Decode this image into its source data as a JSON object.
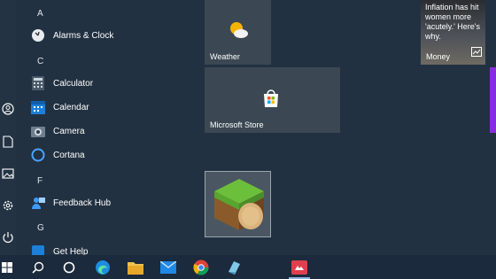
{
  "applist": {
    "sections": [
      {
        "letter": "A"
      },
      {
        "letter": "C"
      },
      {
        "letter": "F"
      },
      {
        "letter": "G"
      }
    ],
    "apps": [
      {
        "label": "Alarms & Clock",
        "icon": "alarm-clock-icon"
      },
      {
        "label": "Calculator",
        "icon": "calculator-icon"
      },
      {
        "label": "Calendar",
        "icon": "calendar-icon"
      },
      {
        "label": "Camera",
        "icon": "camera-icon"
      },
      {
        "label": "Cortana",
        "icon": "cortana-icon"
      },
      {
        "label": "Feedback Hub",
        "icon": "feedback-hub-icon"
      },
      {
        "label": "Get Help",
        "icon": "get-help-icon"
      }
    ]
  },
  "rail": {
    "icons": [
      "user-icon",
      "documents-icon",
      "pictures-icon",
      "settings-icon",
      "power-icon"
    ]
  },
  "tiles": {
    "weather": {
      "label": "Weather",
      "icon": "weather-icon"
    },
    "store": {
      "label": "Microsoft Store",
      "icon": "store-icon"
    },
    "money": {
      "headline": "Inflation has hit women more 'acutely.' Here's why.",
      "label": "Money"
    },
    "minecraft": {
      "icon": "minecraft-icon"
    }
  },
  "taskbar": {
    "icons": [
      "start-icon",
      "search-icon",
      "task-view-icon",
      "edge-icon",
      "file-explorer-icon",
      "mail-icon",
      "chrome-icon",
      "app-icon",
      "app-red-icon"
    ]
  },
  "colors": {
    "background": "#223141",
    "tile": "#3b4853",
    "taskbar": "#1b2a3c",
    "accent": "#0078d7"
  }
}
